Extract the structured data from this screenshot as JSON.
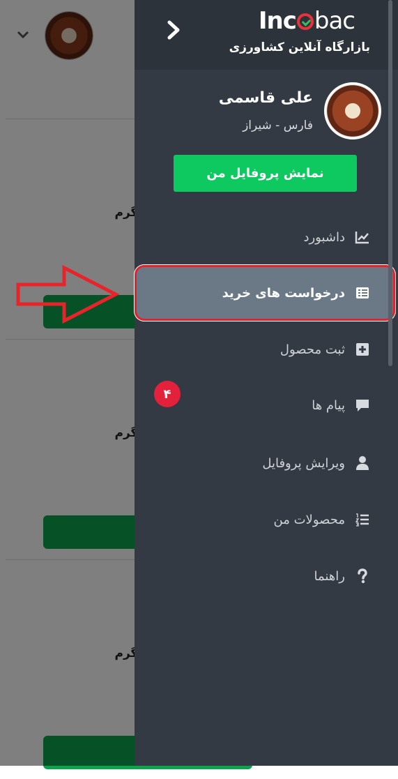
{
  "background": {
    "cards": [
      {
        "weight_label": "وگرم"
      },
      {
        "weight_label": "وگرم"
      },
      {
        "weight_label": "وگرم"
      }
    ]
  },
  "drawer": {
    "logo_part1": "Inc",
    "logo_part2": "bac",
    "tagline": "بازارگاه آنلاین کشاورزی",
    "profile": {
      "name": "علی قاسمی",
      "location": "فارس - شیراز",
      "button_label": "نمایش پروفایل من"
    },
    "menu": [
      {
        "label": "داشبورد",
        "icon": "chart-icon"
      },
      {
        "label": "درخواست های خرید",
        "icon": "list-icon",
        "active": true
      },
      {
        "label": "ثبت محصول",
        "icon": "plus-square-icon"
      },
      {
        "label": "پیام ها",
        "icon": "chat-icon",
        "badge": "۴"
      },
      {
        "label": "ویرایش پروفایل",
        "icon": "user-icon"
      },
      {
        "label": "محصولات من",
        "icon": "numbered-list-icon"
      },
      {
        "label": "راهنما",
        "icon": "question-icon"
      }
    ]
  },
  "colors": {
    "drawer_bg": "#343a43",
    "active_item_bg": "#6b7886",
    "highlight_red": "#e0242d",
    "primary_green": "#0ec95f",
    "badge_red": "#e3213a"
  }
}
